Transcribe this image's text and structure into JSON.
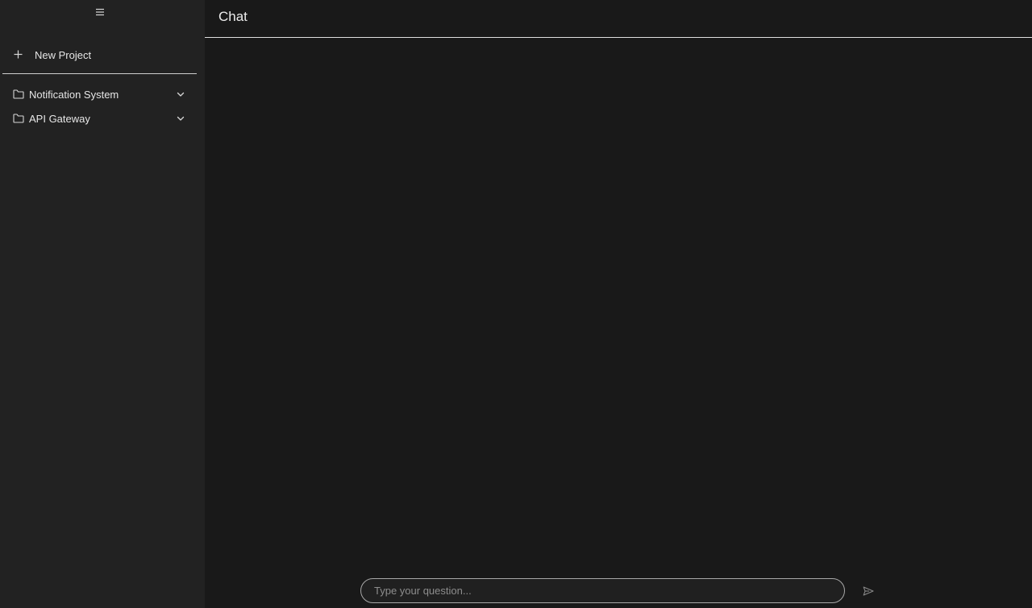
{
  "sidebar": {
    "toggle_icon": "menu-icon",
    "new_project_label": "New Project",
    "projects": [
      {
        "label": "Notification System",
        "icon": "folder-icon",
        "expand_icon": "chevron-down-icon"
      },
      {
        "label": "API Gateway",
        "icon": "folder-icon",
        "expand_icon": "chevron-down-icon"
      }
    ]
  },
  "header": {
    "title": "Chat"
  },
  "composer": {
    "placeholder": "Type your question...",
    "value": "",
    "send_icon": "send-icon"
  },
  "colors": {
    "background": "#191919",
    "sidebar": "#222222",
    "text": "#e6e6e6",
    "border": "#a8a8a8"
  }
}
